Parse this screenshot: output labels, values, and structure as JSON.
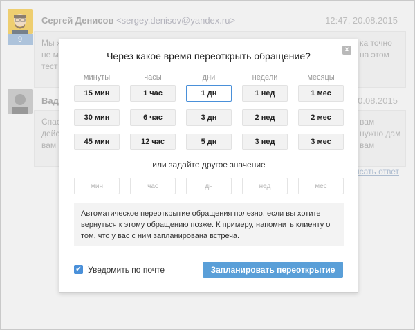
{
  "conversation": {
    "message1": {
      "sender_name": "Сергей Денисов",
      "sender_email": "<sergey.denisov@yandex.ru>",
      "timestamp": "12:47, 20.08.2015",
      "badge_count": "9",
      "text_left": [
        "Мы ж",
        "не м",
        "тест"
      ],
      "text_right": [
        "ка точно",
        "на этом"
      ]
    },
    "message2": {
      "sender_name": "Вади",
      "timestamp": "20.08.2015",
      "text_left": [
        "Спас",
        "дейс",
        "вам"
      ],
      "text_right": [
        "вам",
        "нужно дам",
        "вам"
      ]
    },
    "reply_link": "исать ответ"
  },
  "modal": {
    "title": "Через какое время переоткрыть обращение?",
    "close_glyph": "×",
    "columns": [
      "минуты",
      "часы",
      "дни",
      "недели",
      "месяцы"
    ],
    "rows": [
      [
        "15 мин",
        "1 час",
        "1 дн",
        "1 нед",
        "1 мес"
      ],
      [
        "30 мин",
        "6 час",
        "3 дн",
        "2 нед",
        "2 мес"
      ],
      [
        "45 мин",
        "12 час",
        "5 дн",
        "3 нед",
        "3 мес"
      ]
    ],
    "selected": "1 дн",
    "alt_label": "или задайте другое значение",
    "custom_placeholders": [
      "мин",
      "час",
      "дн",
      "нед",
      "мес"
    ],
    "info_text": "Автоматическое переоткрытие обращения полезно, если вы хотите вернуться к этому обращению позже. К примеру, напомнить клиенту о том, что у вас с ним запланирована встреча.",
    "notify_label": "Уведомить по почте",
    "notify_checked": true,
    "submit_label": "Запланировать переоткрытие"
  },
  "colors": {
    "accent": "#4a90d9",
    "primary_button": "#5a9fd8"
  }
}
